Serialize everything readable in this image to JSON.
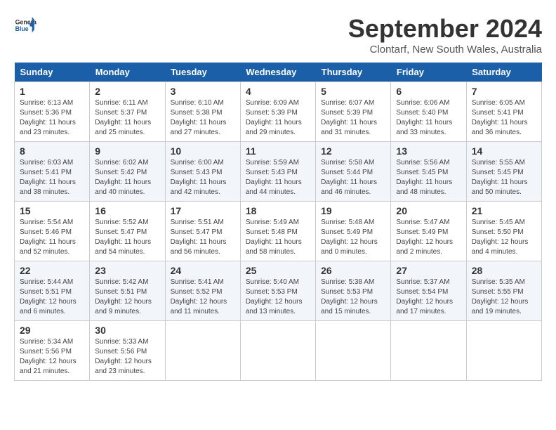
{
  "header": {
    "logo_line1": "General",
    "logo_line2": "Blue",
    "month": "September 2024",
    "location": "Clontarf, New South Wales, Australia"
  },
  "weekdays": [
    "Sunday",
    "Monday",
    "Tuesday",
    "Wednesday",
    "Thursday",
    "Friday",
    "Saturday"
  ],
  "weeks": [
    [
      {
        "day": "1",
        "sunrise": "6:13 AM",
        "sunset": "5:36 PM",
        "daylight": "11 hours and 23 minutes."
      },
      {
        "day": "2",
        "sunrise": "6:11 AM",
        "sunset": "5:37 PM",
        "daylight": "11 hours and 25 minutes."
      },
      {
        "day": "3",
        "sunrise": "6:10 AM",
        "sunset": "5:38 PM",
        "daylight": "11 hours and 27 minutes."
      },
      {
        "day": "4",
        "sunrise": "6:09 AM",
        "sunset": "5:39 PM",
        "daylight": "11 hours and 29 minutes."
      },
      {
        "day": "5",
        "sunrise": "6:07 AM",
        "sunset": "5:39 PM",
        "daylight": "11 hours and 31 minutes."
      },
      {
        "day": "6",
        "sunrise": "6:06 AM",
        "sunset": "5:40 PM",
        "daylight": "11 hours and 33 minutes."
      },
      {
        "day": "7",
        "sunrise": "6:05 AM",
        "sunset": "5:41 PM",
        "daylight": "11 hours and 36 minutes."
      }
    ],
    [
      {
        "day": "8",
        "sunrise": "6:03 AM",
        "sunset": "5:41 PM",
        "daylight": "11 hours and 38 minutes."
      },
      {
        "day": "9",
        "sunrise": "6:02 AM",
        "sunset": "5:42 PM",
        "daylight": "11 hours and 40 minutes."
      },
      {
        "day": "10",
        "sunrise": "6:00 AM",
        "sunset": "5:43 PM",
        "daylight": "11 hours and 42 minutes."
      },
      {
        "day": "11",
        "sunrise": "5:59 AM",
        "sunset": "5:43 PM",
        "daylight": "11 hours and 44 minutes."
      },
      {
        "day": "12",
        "sunrise": "5:58 AM",
        "sunset": "5:44 PM",
        "daylight": "11 hours and 46 minutes."
      },
      {
        "day": "13",
        "sunrise": "5:56 AM",
        "sunset": "5:45 PM",
        "daylight": "11 hours and 48 minutes."
      },
      {
        "day": "14",
        "sunrise": "5:55 AM",
        "sunset": "5:45 PM",
        "daylight": "11 hours and 50 minutes."
      }
    ],
    [
      {
        "day": "15",
        "sunrise": "5:54 AM",
        "sunset": "5:46 PM",
        "daylight": "11 hours and 52 minutes."
      },
      {
        "day": "16",
        "sunrise": "5:52 AM",
        "sunset": "5:47 PM",
        "daylight": "11 hours and 54 minutes."
      },
      {
        "day": "17",
        "sunrise": "5:51 AM",
        "sunset": "5:47 PM",
        "daylight": "11 hours and 56 minutes."
      },
      {
        "day": "18",
        "sunrise": "5:49 AM",
        "sunset": "5:48 PM",
        "daylight": "11 hours and 58 minutes."
      },
      {
        "day": "19",
        "sunrise": "5:48 AM",
        "sunset": "5:49 PM",
        "daylight": "12 hours and 0 minutes."
      },
      {
        "day": "20",
        "sunrise": "5:47 AM",
        "sunset": "5:49 PM",
        "daylight": "12 hours and 2 minutes."
      },
      {
        "day": "21",
        "sunrise": "5:45 AM",
        "sunset": "5:50 PM",
        "daylight": "12 hours and 4 minutes."
      }
    ],
    [
      {
        "day": "22",
        "sunrise": "5:44 AM",
        "sunset": "5:51 PM",
        "daylight": "12 hours and 6 minutes."
      },
      {
        "day": "23",
        "sunrise": "5:42 AM",
        "sunset": "5:51 PM",
        "daylight": "12 hours and 9 minutes."
      },
      {
        "day": "24",
        "sunrise": "5:41 AM",
        "sunset": "5:52 PM",
        "daylight": "12 hours and 11 minutes."
      },
      {
        "day": "25",
        "sunrise": "5:40 AM",
        "sunset": "5:53 PM",
        "daylight": "12 hours and 13 minutes."
      },
      {
        "day": "26",
        "sunrise": "5:38 AM",
        "sunset": "5:53 PM",
        "daylight": "12 hours and 15 minutes."
      },
      {
        "day": "27",
        "sunrise": "5:37 AM",
        "sunset": "5:54 PM",
        "daylight": "12 hours and 17 minutes."
      },
      {
        "day": "28",
        "sunrise": "5:35 AM",
        "sunset": "5:55 PM",
        "daylight": "12 hours and 19 minutes."
      }
    ],
    [
      {
        "day": "29",
        "sunrise": "5:34 AM",
        "sunset": "5:56 PM",
        "daylight": "12 hours and 21 minutes."
      },
      {
        "day": "30",
        "sunrise": "5:33 AM",
        "sunset": "5:56 PM",
        "daylight": "12 hours and 23 minutes."
      },
      null,
      null,
      null,
      null,
      null
    ]
  ]
}
